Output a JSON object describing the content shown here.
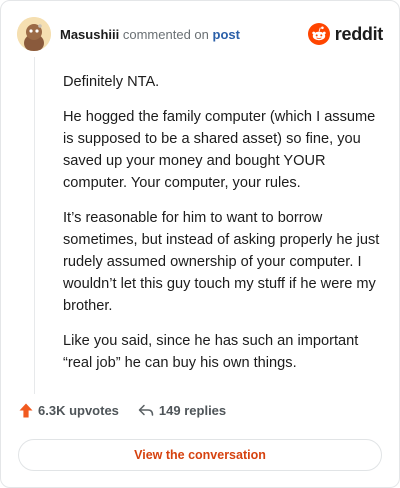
{
  "header": {
    "username": "Masushiii",
    "action_text": "commented on",
    "post_link": "post",
    "brand": "reddit"
  },
  "comment": {
    "paragraphs": [
      "Definitely NTA.",
      "He hogged the family computer (which I assume is supposed to be a shared asset) so fine, you saved up your money and bought YOUR computer. Your computer, your rules.",
      "It’s reasonable for him to want to borrow sometimes, but instead of asking properly he just rudely assumed ownership of your computer. I wouldn’t let this guy touch my stuff if he were my brother.",
      "Like you said, since he has such an important “real job” he can buy his own things."
    ]
  },
  "actions": {
    "upvotes": "6.3K upvotes",
    "replies": "149 replies"
  },
  "view_button": "View the conversation",
  "colors": {
    "brand_orange": "#ff4500",
    "button_text": "#d6420f",
    "upvote_icon": "#f15a1f"
  },
  "icons": {
    "avatar": "snoo-avatar",
    "brand": "reddit-logo-icon",
    "upvote": "upvote-arrow-icon",
    "reply": "reply-arrow-icon"
  }
}
